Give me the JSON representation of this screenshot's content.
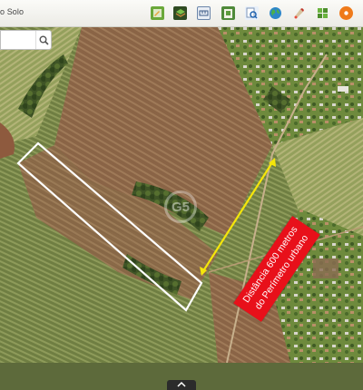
{
  "toolbar": {
    "title": "o Solo",
    "tools": [
      {
        "name": "edit-map-icon",
        "color": "#6aa83a"
      },
      {
        "name": "layers-icon",
        "color": "#3a7a2c"
      },
      {
        "name": "scale-icon",
        "color": "#5a7aa0"
      },
      {
        "name": "legend-icon",
        "color": "#4f8a3a"
      },
      {
        "name": "document-search-icon",
        "color": "#2f6fb3"
      },
      {
        "name": "globe-icon",
        "color": "#2b8f4a"
      },
      {
        "name": "paint-icon",
        "color": "#c99a3a"
      },
      {
        "name": "puzzle-icon",
        "color": "#5b9e3c"
      },
      {
        "name": "help-icon",
        "color": "#ef7a1a"
      }
    ]
  },
  "search": {
    "placeholder": "",
    "value": ""
  },
  "map": {
    "annotation_line1": "Distância 600 metros",
    "annotation_line2": "do Perímetro urbano",
    "annotation_color": "#e8101a",
    "arrow_color": "#f5e60a",
    "parcel_outline_color": "#ffffff",
    "watermark": "G5"
  }
}
